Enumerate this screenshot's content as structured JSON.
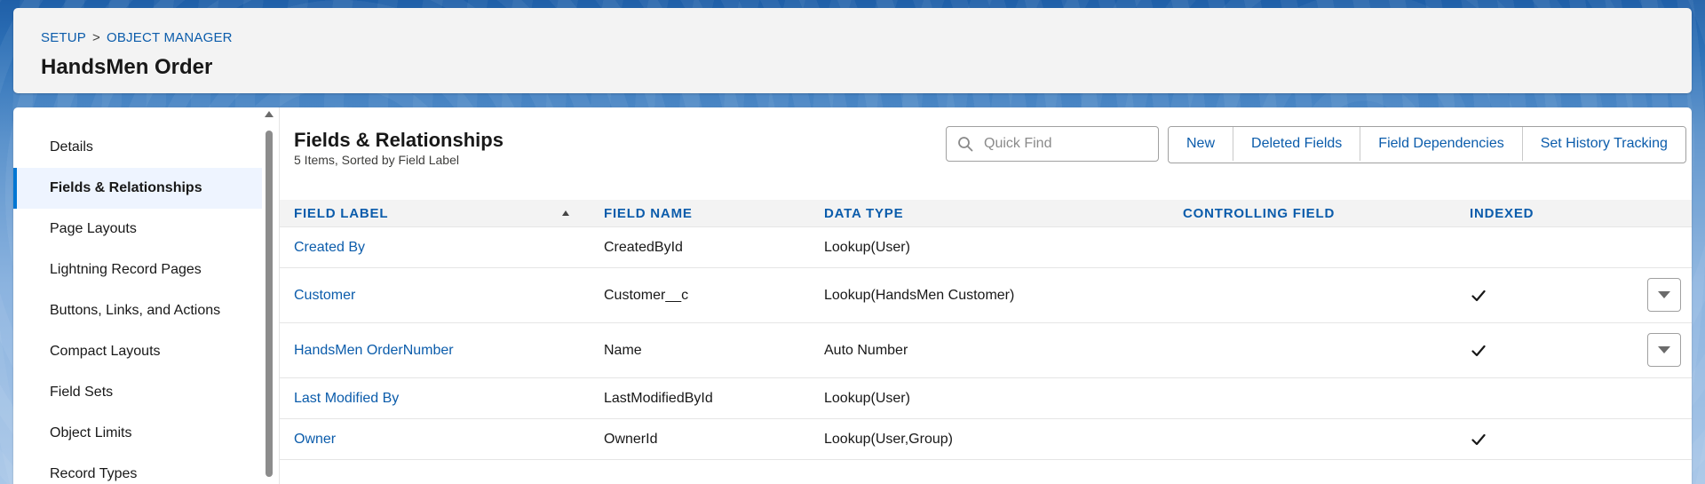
{
  "breadcrumb": {
    "items": [
      "SETUP",
      "OBJECT MANAGER"
    ],
    "separator": ">"
  },
  "header": {
    "title": "HandsMen Order"
  },
  "sidebar": {
    "items": [
      {
        "label": "Details",
        "active": false
      },
      {
        "label": "Fields & Relationships",
        "active": true
      },
      {
        "label": "Page Layouts",
        "active": false
      },
      {
        "label": "Lightning Record Pages",
        "active": false
      },
      {
        "label": "Buttons, Links, and Actions",
        "active": false
      },
      {
        "label": "Compact Layouts",
        "active": false
      },
      {
        "label": "Field Sets",
        "active": false
      },
      {
        "label": "Object Limits",
        "active": false
      },
      {
        "label": "Record Types",
        "active": false
      }
    ]
  },
  "main": {
    "title": "Fields & Relationships",
    "subtitle": "5 Items, Sorted by Field Label",
    "search": {
      "placeholder": "Quick Find",
      "value": ""
    },
    "buttons": {
      "new": "New",
      "deleted_fields": "Deleted Fields",
      "field_dependencies": "Field Dependencies",
      "set_history_tracking": "Set History Tracking"
    }
  },
  "table": {
    "columns": {
      "field_label": "FIELD LABEL",
      "field_name": "FIELD NAME",
      "data_type": "DATA TYPE",
      "controlling_field": "CONTROLLING FIELD",
      "indexed": "INDEXED"
    },
    "sort": {
      "column": "field_label",
      "direction": "ascending"
    },
    "rows": [
      {
        "field_label": "Created By",
        "field_name": "CreatedById",
        "data_type": "Lookup(User)",
        "controlling_field": "",
        "indexed": false,
        "has_menu": false
      },
      {
        "field_label": "Customer",
        "field_name": "Customer__c",
        "data_type": "Lookup(HandsMen Customer)",
        "controlling_field": "",
        "indexed": true,
        "has_menu": true
      },
      {
        "field_label": "HandsMen OrderNumber",
        "field_name": "Name",
        "data_type": "Auto Number",
        "controlling_field": "",
        "indexed": true,
        "has_menu": true
      },
      {
        "field_label": "Last Modified By",
        "field_name": "LastModifiedById",
        "data_type": "Lookup(User)",
        "controlling_field": "",
        "indexed": false,
        "has_menu": false
      },
      {
        "field_label": "Owner",
        "field_name": "OwnerId",
        "data_type": "Lookup(User,Group)",
        "controlling_field": "",
        "indexed": true,
        "has_menu": false
      }
    ]
  },
  "colors": {
    "link": "#0b5cab",
    "active_indicator": "#0176d3",
    "active_bg": "#eef4ff",
    "header_bg": "#f3f3f3"
  },
  "icons": {
    "search": "search-icon",
    "indexed": "check-icon",
    "row_menu": "chevron-down-icon",
    "sort": "sort-ascending-icon"
  }
}
